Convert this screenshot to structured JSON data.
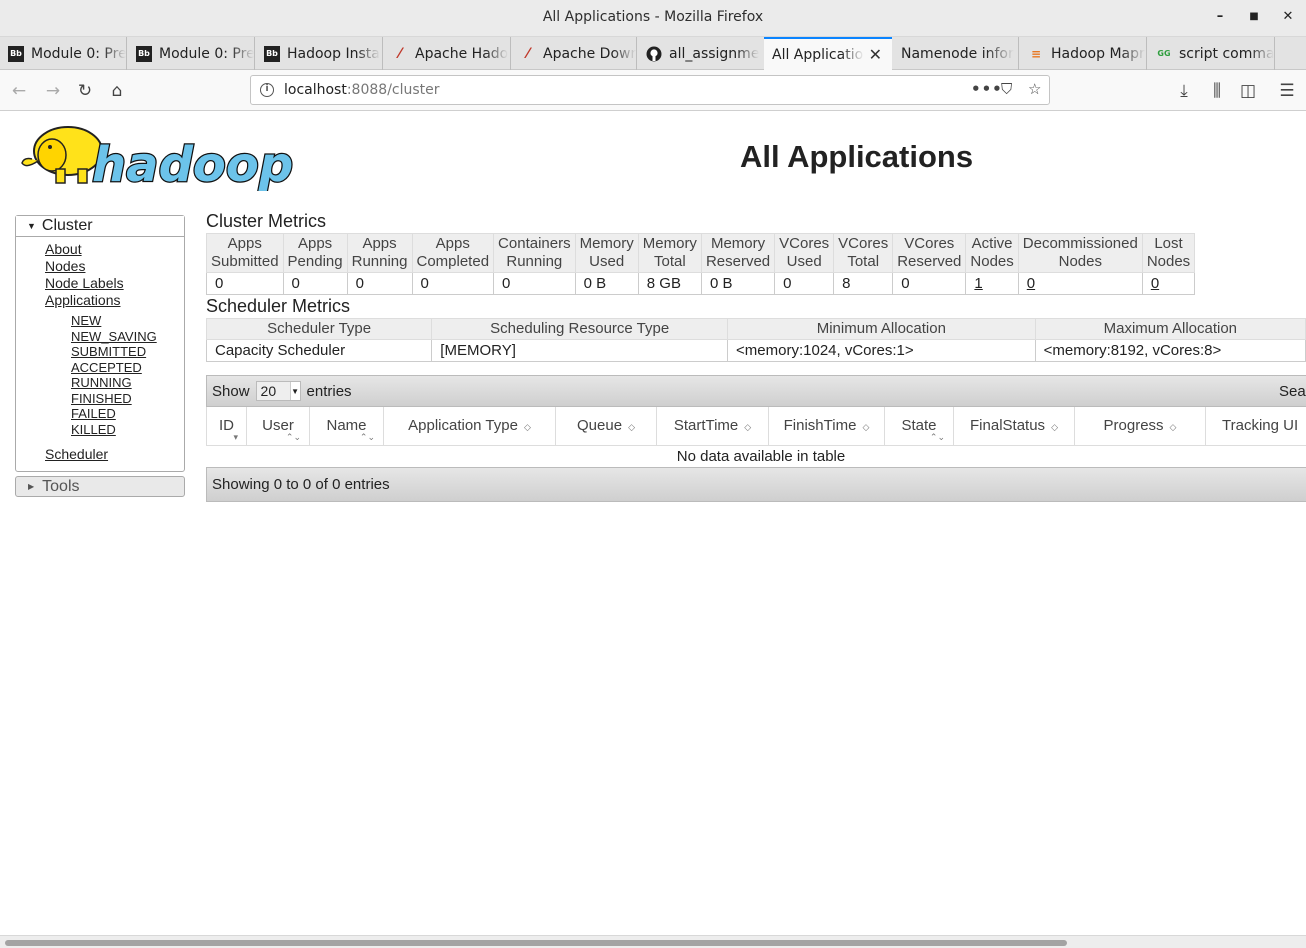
{
  "window": {
    "title": "All Applications - Mozilla Firefox"
  },
  "tabs": [
    {
      "label": "Module 0: Pre",
      "icon": "blackboard-icon"
    },
    {
      "label": "Module 0: Pre",
      "icon": "blackboard-icon"
    },
    {
      "label": "Hadoop Insta",
      "icon": "blackboard-icon"
    },
    {
      "label": "Apache Hado",
      "icon": "apache-feather-icon"
    },
    {
      "label": "Apache Down",
      "icon": "apache-feather-icon"
    },
    {
      "label": "all_assignme",
      "icon": "github-icon"
    },
    {
      "label": "All Application",
      "icon": "none",
      "active": true
    },
    {
      "label": "Namenode infor",
      "icon": "none"
    },
    {
      "label": "Hadoop Mapr",
      "icon": "stackoverflow-icon"
    },
    {
      "label": "script comma",
      "icon": "gg-icon"
    }
  ],
  "address": {
    "host": "localhost",
    "rest": ":8088/cluster"
  },
  "page": {
    "title": "All Applications"
  },
  "sidebar": {
    "cluster_label": "Cluster",
    "links": [
      "About",
      "Nodes",
      "Node Labels",
      "Applications"
    ],
    "app_states": [
      "NEW",
      "NEW_SAVING",
      "SUBMITTED",
      "ACCEPTED",
      "RUNNING",
      "FINISHED",
      "FAILED",
      "KILLED"
    ],
    "scheduler": "Scheduler",
    "tools_label": "Tools"
  },
  "cluster_metrics": {
    "heading": "Cluster Metrics",
    "headers": [
      [
        "Apps",
        "Submitted"
      ],
      [
        "Apps",
        "Pending"
      ],
      [
        "Apps",
        "Running"
      ],
      [
        "Apps",
        "Completed"
      ],
      [
        "Containers",
        "Running"
      ],
      [
        "Memory",
        "Used"
      ],
      [
        "Memory",
        "Total"
      ],
      [
        "Memory",
        "Reserved"
      ],
      [
        "VCores",
        "Used"
      ],
      [
        "VCores",
        "Total"
      ],
      [
        "VCores",
        "Reserved"
      ],
      [
        "Active",
        "Nodes"
      ],
      [
        "Decommissioned",
        "Nodes"
      ],
      [
        "Lost",
        "Nodes"
      ]
    ],
    "values": [
      "0",
      "0",
      "0",
      "0",
      "0",
      "0 B",
      "8 GB",
      "0 B",
      "0",
      "8",
      "0",
      "1",
      "0",
      "0"
    ]
  },
  "scheduler_metrics": {
    "heading": "Scheduler Metrics",
    "headers": [
      "Scheduler Type",
      "Scheduling Resource Type",
      "Minimum Allocation",
      "Maximum Allocation"
    ],
    "values": [
      "Capacity Scheduler",
      "[MEMORY]",
      "<memory:1024, vCores:1>",
      "<memory:8192, vCores:8>"
    ]
  },
  "apps_table": {
    "show_label": "Show",
    "page_size": "20",
    "entries_label": "entries",
    "search_label": "Search:",
    "columns": [
      "ID",
      "User",
      "Name",
      "Application Type",
      "Queue",
      "StartTime",
      "FinishTime",
      "State",
      "FinalStatus",
      "Progress",
      "Tracking UI"
    ],
    "empty_message": "No data available in table",
    "info": "Showing 0 to 0 of 0 entries"
  }
}
